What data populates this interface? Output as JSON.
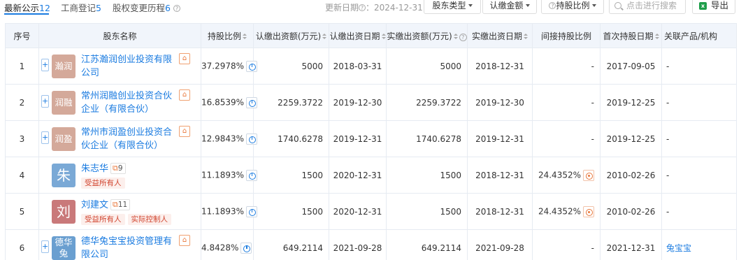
{
  "tabs": [
    {
      "label": "最新公示",
      "count": "12"
    },
    {
      "label": "工商登记",
      "count": "5"
    },
    {
      "label": "股权变更历程",
      "count": "6"
    }
  ],
  "update_date": "更新日期",
  "update_value": "：2024-12-31",
  "filters": {
    "shareholder_type": "股东类型",
    "subscribed_amount": "认缴金额",
    "ratio": "持股比例"
  },
  "search": {
    "placeholder": "点击进行搜索"
  },
  "export_label": "导出",
  "columns": {
    "idx": "序号",
    "name": "股东名称",
    "ratio": "持股比例",
    "sub_amount": "认缴出资额(万元)",
    "sub_date": "认缴出资日期",
    "paid_amount": "实缴出资额(万元)",
    "paid_date": "实缴出资日期",
    "indirect": "间接持股比例",
    "first_date": "首次持股日期",
    "related": "关联产品/机构"
  },
  "rows": [
    {
      "idx": "1",
      "logo": "瀚润",
      "name": "江苏瀚润创业投资有限公司",
      "ratio": "37.2978%",
      "sub_amount": "5000",
      "sub_date": "2018-03-31",
      "paid_amount": "5000",
      "paid_date": "2018-12-31",
      "indirect": "-",
      "first_date": "2017-09-05",
      "related": "-"
    },
    {
      "idx": "2",
      "logo": "润融",
      "name": "常州润融创业投资合伙企业（有限合伙）",
      "ratio": "16.8539%",
      "sub_amount": "2259.3722",
      "sub_date": "2019-12-30",
      "paid_amount": "2259.3722",
      "paid_date": "2019-12-30",
      "indirect": "-",
      "first_date": "2019-12-25",
      "related": "-"
    },
    {
      "idx": "3",
      "logo": "润盈",
      "name": "常州市润盈创业投资合伙企业（有限合伙）",
      "ratio": "12.9843%",
      "sub_amount": "1740.6278",
      "sub_date": "2019-12-31",
      "paid_amount": "1740.6278",
      "paid_date": "2019-12-31",
      "indirect": "-",
      "first_date": "2019-12-25",
      "related": "-"
    },
    {
      "idx": "4",
      "logo": "朱",
      "name": "朱志华",
      "rel_count": "9",
      "tags": [
        "受益所有人"
      ],
      "ratio": "11.1893%",
      "sub_amount": "1500",
      "sub_date": "2020-12-31",
      "paid_amount": "1500",
      "paid_date": "2018-12-31",
      "indirect": "24.4352%",
      "first_date": "2010-02-26",
      "related": "-"
    },
    {
      "idx": "5",
      "logo": "刘",
      "name": "刘建文",
      "rel_count": "11",
      "tags": [
        "受益所有人",
        "实际控制人"
      ],
      "ratio": "11.1893%",
      "sub_amount": "1500",
      "sub_date": "2020-12-31",
      "paid_amount": "1500",
      "paid_date": "2018-12-31",
      "indirect": "24.4352%",
      "first_date": "2010-02-26",
      "related": "-"
    },
    {
      "idx": "6",
      "logo": "德华兔",
      "name": "德华兔宝宝投资管理有限公司",
      "ratio": "4.8428%",
      "sub_amount": "649.2114",
      "sub_date": "2021-09-28",
      "paid_amount": "649.2114",
      "paid_date": "2021-09-28",
      "indirect": "-",
      "first_date": "2021-12-31",
      "related": "兔宝宝"
    }
  ],
  "colors": {
    "accent": "#1a7be0",
    "logo_brown": "#d4a99a",
    "logo_blue": "#7aa9d6",
    "logo_red": "#c9797a",
    "logo_blue2": "#6a9fd0"
  }
}
